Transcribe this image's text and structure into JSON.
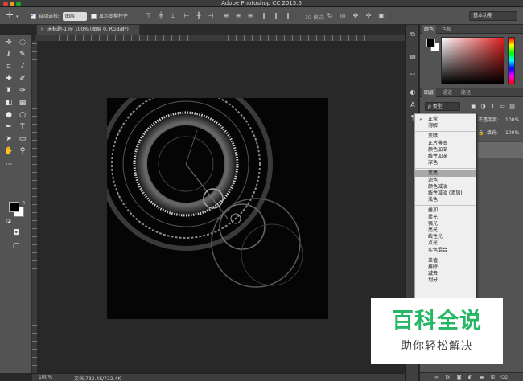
{
  "window": {
    "title": "Adobe Photoshop CC 2015.5"
  },
  "options_bar": {
    "auto_select_label": "自动选择:",
    "auto_select_value": "图层",
    "show_transform_label": "显示变换控件",
    "mode_3d_label": "3D 模式:",
    "workspace": "基本功能"
  },
  "document": {
    "tab_title": "未标题-1 @ 100% (图层 0, RGB/8*)",
    "close_glyph": "×"
  },
  "status": {
    "zoom": "100%",
    "doc_info": "文档:732.4K/732.4K"
  },
  "color_panel": {
    "tabs": [
      "颜色",
      "色板"
    ],
    "fg_color": "#000000",
    "bg_color": "#ffffff"
  },
  "layers_panel": {
    "tabs": [
      "图层",
      "通道",
      "路径"
    ],
    "kind_filter": "ρ 类型",
    "opacity_label": "不透明度:",
    "opacity_value": "100%",
    "fill_label": "填充:",
    "fill_value": "100%",
    "footer_fx": "fx"
  },
  "blend_menu": {
    "checked_mark": "✓",
    "groups": [
      [
        "正常",
        "溶解"
      ],
      [
        "变暗",
        "正片叠底",
        "颜色加深",
        "线性加深",
        "深色"
      ],
      [
        "变亮",
        "滤色",
        "颜色减淡",
        "线性减淡 (添加)",
        "浅色"
      ],
      [
        "叠加",
        "柔光",
        "强光",
        "亮光",
        "线性光",
        "点光",
        "实色混合"
      ],
      [
        "差值",
        "排除",
        "减去",
        "划分"
      ]
    ],
    "checked": "正常",
    "highlighted": "变亮"
  },
  "watermark": {
    "title": "百科全说",
    "subtitle": "助你轻松解决"
  },
  "tools": [
    "move-icon",
    "marquee-icon",
    "lasso-icon",
    "quick-select-icon",
    "crop-icon",
    "eyedropper-icon",
    "healing-icon",
    "brush-icon",
    "stamp-icon",
    "history-brush-icon",
    "eraser-icon",
    "gradient-icon",
    "blur-icon",
    "dodge-icon",
    "pen-icon",
    "type-icon",
    "path-select-icon",
    "shape-icon",
    "hand-icon",
    "zoom-icon"
  ]
}
